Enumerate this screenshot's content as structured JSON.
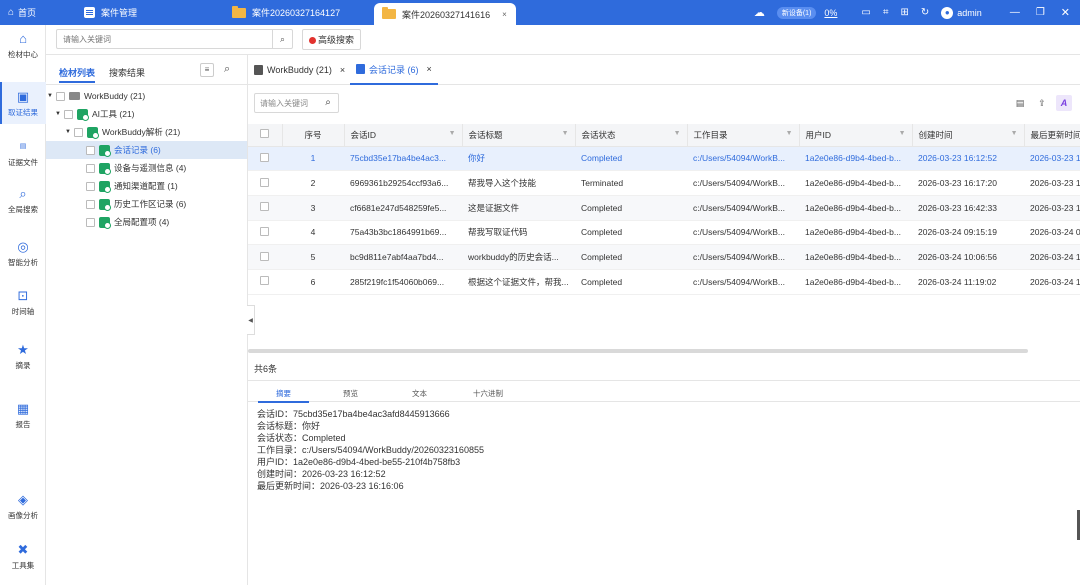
{
  "titlebar": {
    "home": "首页",
    "tabs": [
      {
        "label": "案件管理"
      },
      {
        "label": "案件20260327164127"
      },
      {
        "label": "案件20260327141616"
      }
    ],
    "close": "×",
    "new_device": "新设备(1)",
    "progress": "0%",
    "user": "admin"
  },
  "sidebar": {
    "items": [
      {
        "label": "检材中心",
        "icon": "home-icon"
      },
      {
        "label": "取证结果",
        "icon": "inbox-icon"
      },
      {
        "label": "证据文件",
        "icon": "file-icon"
      },
      {
        "label": "全局搜索",
        "icon": "search-icon"
      },
      {
        "label": "智能分析",
        "icon": "brain-icon"
      },
      {
        "label": "时间轴",
        "icon": "timeline-icon"
      },
      {
        "label": "摘录",
        "icon": "bookmark-icon"
      },
      {
        "label": "报告",
        "icon": "report-icon"
      },
      {
        "label": "画像分析",
        "icon": "profile-icon"
      },
      {
        "label": "工具集",
        "icon": "tools-icon"
      }
    ]
  },
  "search": {
    "placeholder": "请输入关键词",
    "advanced": "高级搜索"
  },
  "left_panel": {
    "tab_list": "检材列表",
    "tab_results": "搜索结果",
    "tree": [
      {
        "label": "WorkBuddy (21)"
      },
      {
        "label": "AI工具 (21)"
      },
      {
        "label": "WorkBuddy解析 (21)"
      },
      {
        "label": "会话记录 (6)"
      },
      {
        "label": "设备与遥测信息 (4)"
      },
      {
        "label": "通知渠道配置 (1)"
      },
      {
        "label": "历史工作区记录 (6)"
      },
      {
        "label": "全局配置项 (4)"
      }
    ]
  },
  "main": {
    "tabs": [
      {
        "label": "WorkBuddy (21)"
      },
      {
        "label": "会话记录 (6)"
      }
    ],
    "table_search_placeholder": "请输入关键词",
    "columns": [
      "序号",
      "会话ID",
      "会话标题",
      "会话状态",
      "工作目录",
      "用户ID",
      "创建时间",
      "最后更新时间"
    ],
    "rows": [
      {
        "no": "1",
        "id": "75cbd35e17ba4be4ac3...",
        "title": "你好",
        "status": "Completed",
        "dir": "c:/Users/54094/WorkB...",
        "uid": "1a2e0e86-d9b4-4bed-b...",
        "created": "2026-03-23 16:12:52",
        "updated": "2026-03-23 1"
      },
      {
        "no": "2",
        "id": "6969361b29254ccf93a6...",
        "title": "帮我导入这个技能",
        "status": "Terminated",
        "dir": "c:/Users/54094/WorkB...",
        "uid": "1a2e0e86-d9b4-4bed-b...",
        "created": "2026-03-23 16:17:20",
        "updated": "2026-03-23 1"
      },
      {
        "no": "3",
        "id": "cf6681e247d548259fe5...",
        "title": "这是证据文件",
        "status": "Completed",
        "dir": "c:/Users/54094/WorkB...",
        "uid": "1a2e0e86-d9b4-4bed-b...",
        "created": "2026-03-23 16:42:33",
        "updated": "2026-03-23 1"
      },
      {
        "no": "4",
        "id": "75a43b3bc1864991b69...",
        "title": "帮我写取证代码",
        "status": "Completed",
        "dir": "c:/Users/54094/WorkB...",
        "uid": "1a2e0e86-d9b4-4bed-b...",
        "created": "2026-03-24 09:15:19",
        "updated": "2026-03-24 0"
      },
      {
        "no": "5",
        "id": "bc9d811e7abf4aa7bd4...",
        "title": "workbuddy的历史会话...",
        "status": "Completed",
        "dir": "c:/Users/54094/WorkB...",
        "uid": "1a2e0e86-d9b4-4bed-b...",
        "created": "2026-03-24 10:06:56",
        "updated": "2026-03-24 1"
      },
      {
        "no": "6",
        "id": "285f219fc1f54060b069...",
        "title": "根据这个证据文件，帮我...",
        "status": "Completed",
        "dir": "c:/Users/54094/WorkB...",
        "uid": "1a2e0e86-d9b4-4bed-b...",
        "created": "2026-03-24 11:19:02",
        "updated": "2026-03-24 1"
      }
    ],
    "total": "共6条",
    "preview_tabs": [
      "摘要",
      "预览",
      "文本",
      "十六进制"
    ],
    "details": [
      "会话ID：75cbd35e17ba4be4ac3afd8445913666",
      "会话标题：你好",
      "会话状态：Completed",
      "工作目录：c:/Users/54094/WorkBuddy/20260323160855",
      "用户ID：1a2e0e86-d9b4-4bed-be55-210f4b758fb3",
      "创建时间：2026-03-23 16:12:52",
      "最后更新时间：2026-03-23 16:16:06"
    ]
  },
  "colors": {
    "accent": "#2f6bdc",
    "titlebar": "#2f6bdc",
    "selected_row": "#e8f0fd"
  }
}
